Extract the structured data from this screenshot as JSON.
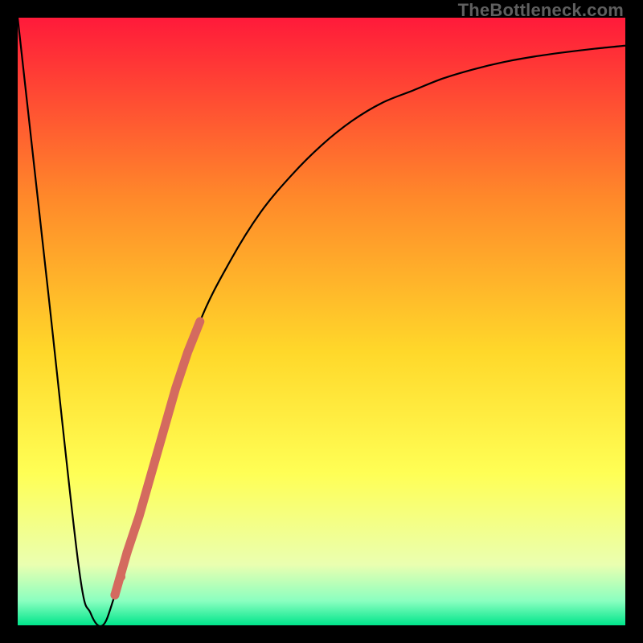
{
  "watermark": "TheBottleneck.com",
  "colors": {
    "black": "#000000",
    "curve": "#000000",
    "marker": "#d46a5f",
    "grad_top": "#ff1a3a",
    "grad_mid1": "#ff8a2a",
    "grad_mid2": "#ffd82a",
    "grad_mid3": "#ffff55",
    "grad_low1": "#eaffb0",
    "grad_low2": "#8affc0",
    "grad_bottom": "#00e58b"
  },
  "chart_data": {
    "type": "line",
    "title": "",
    "xlabel": "",
    "ylabel": "",
    "xlim": [
      0,
      100
    ],
    "ylim": [
      0,
      100
    ],
    "series": [
      {
        "name": "bottleneck-curve",
        "x": [
          0,
          5,
          10,
          12,
          14,
          16,
          20,
          25,
          30,
          35,
          40,
          45,
          50,
          55,
          60,
          65,
          70,
          75,
          80,
          85,
          90,
          95,
          100
        ],
        "values": [
          100,
          55,
          10,
          2,
          0,
          5,
          18,
          35,
          50,
          60,
          68,
          74,
          79,
          83,
          86,
          88,
          90,
          91.5,
          92.7,
          93.6,
          94.3,
          94.9,
          95.4
        ]
      }
    ],
    "markers": {
      "name": "highlight-segment",
      "x": [
        16,
        18,
        20,
        22,
        24,
        26,
        28,
        30
      ],
      "values": [
        5,
        12,
        18,
        25,
        32,
        39,
        45,
        50
      ]
    },
    "extra_points": {
      "name": "dots-near-min",
      "x": [
        16,
        17,
        18
      ],
      "values": [
        5,
        8,
        12
      ]
    }
  }
}
